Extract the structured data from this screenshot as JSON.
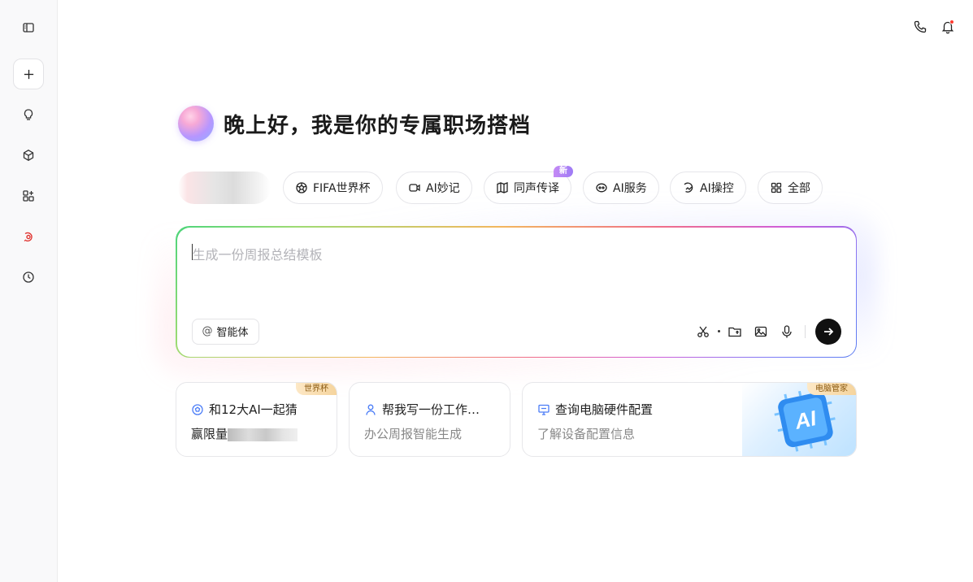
{
  "greeting": {
    "title": "晚上好，我是你的专属职场搭档"
  },
  "chips": [
    {
      "label": "FIFA世界杯",
      "icon": "soccer-icon"
    },
    {
      "label": "AI妙记",
      "icon": "video-icon"
    },
    {
      "label": "同声传译",
      "icon": "map-translate-icon",
      "badge": "新"
    },
    {
      "label": "AI服务",
      "icon": "service-icon"
    },
    {
      "label": "AI操控",
      "icon": "control-icon"
    },
    {
      "label": "全部",
      "icon": "grid-icon"
    }
  ],
  "input": {
    "placeholder": "生成一份周报总结模板",
    "agent_label": "智能体",
    "agent_prefix": "@"
  },
  "cards": [
    {
      "title": "和12大AI一起猜",
      "subtitle": "赢限量",
      "tag": "世界杯",
      "icon": "soccer-icon"
    },
    {
      "title": "帮我写一份工作…",
      "subtitle": "办公周报智能生成",
      "icon": "person-icon"
    },
    {
      "title": "查询电脑硬件配置",
      "subtitle": "了解设备配置信息",
      "tag": "电脑管家",
      "icon": "monitor-icon",
      "art_text": "AI"
    }
  ],
  "colors": {
    "accent": "#111111",
    "badge": "#a77cf5",
    "notification": "#ff3b30"
  }
}
